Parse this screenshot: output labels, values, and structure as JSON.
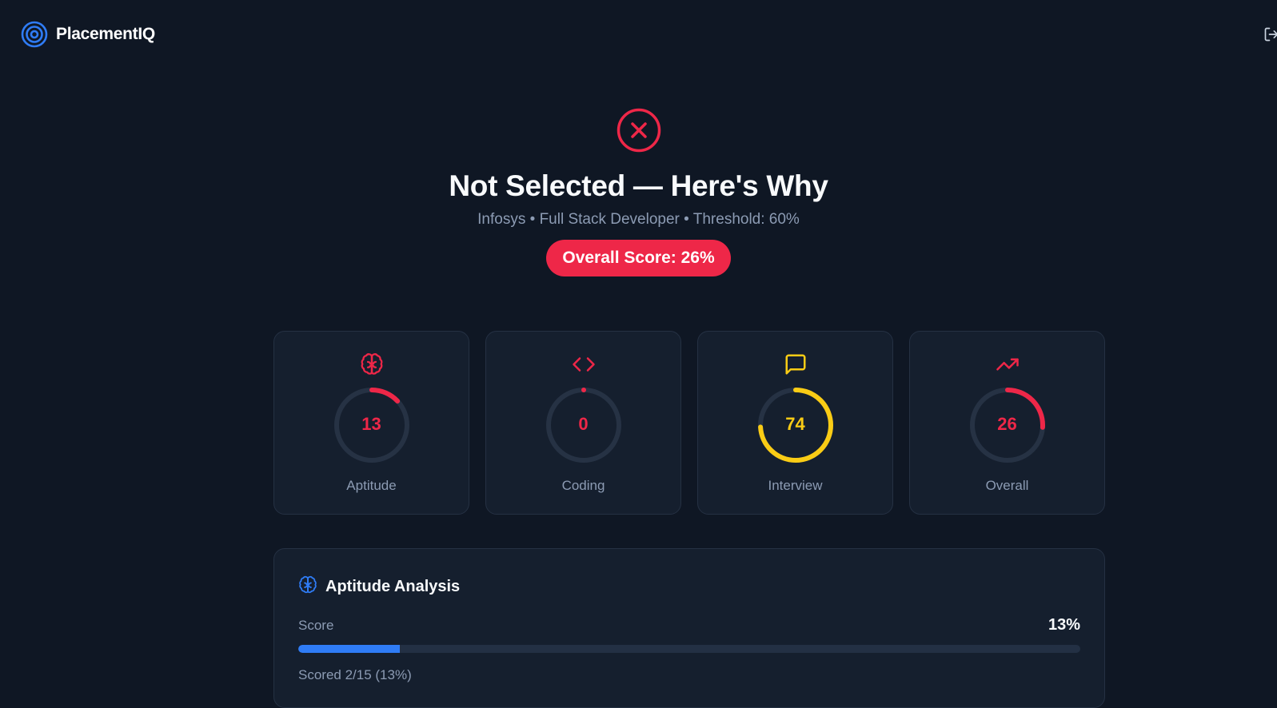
{
  "app": {
    "name": "PlacementIQ"
  },
  "colors": {
    "accent": "#2f7cf6",
    "danger": "#ee2748",
    "warning": "#facc15",
    "track": "#263244"
  },
  "result": {
    "title": "Not Selected — Here's Why",
    "company": "Infosys",
    "role": "Full Stack Developer",
    "threshold": "Threshold: 60%",
    "overall_score": "Overall Score: 26%"
  },
  "cards": [
    {
      "label": "Aptitude",
      "value": "13",
      "percent": 13,
      "color": "#ee2748",
      "icon": "brain-icon"
    },
    {
      "label": "Coding",
      "value": "0",
      "percent": 0,
      "color": "#ee2748",
      "icon": "code-icon"
    },
    {
      "label": "Interview",
      "value": "74",
      "percent": 74,
      "color": "#facc15",
      "icon": "message-icon"
    },
    {
      "label": "Overall",
      "value": "26",
      "percent": 26,
      "color": "#ee2748",
      "icon": "trending-up-icon"
    }
  ],
  "analysis": {
    "title": "Aptitude Analysis",
    "score_label": "Score",
    "score_value": "13%",
    "score_percent": 13,
    "detail": "Scored 2/15 (13%)"
  }
}
